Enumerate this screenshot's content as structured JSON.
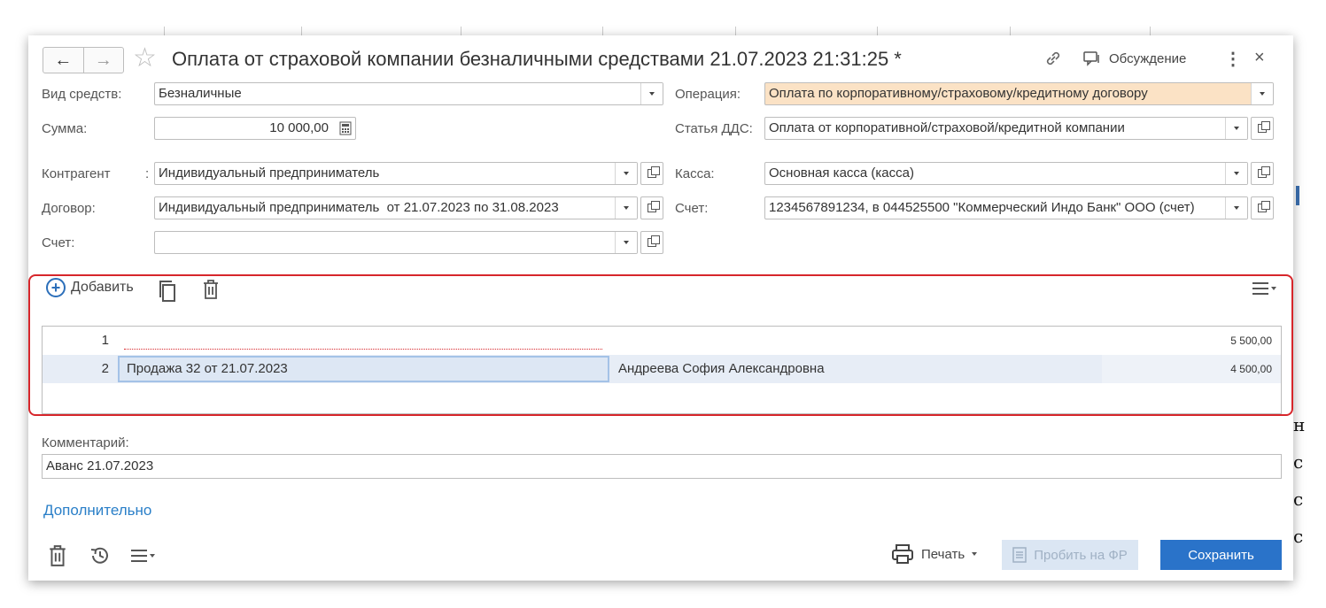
{
  "header": {
    "title": "Оплата от страховой компании безналичными средствами 21.07.2023 21:31:25 *",
    "discuss_label": "Обсуждение"
  },
  "form": {
    "left": [
      {
        "label": "Вид средств:",
        "value": ""
      },
      {
        "label": "Сумма:",
        "value": ""
      },
      {
        "label": "Контрагент",
        "value": ""
      },
      {
        "label": "Договор:",
        "value": ""
      },
      {
        "label": "Счет:",
        "value": ""
      }
    ],
    "fund_type": {
      "label": "Вид средств:",
      "value": "Безналичные"
    },
    "amount": {
      "label": "Сумма:",
      "value": "10 000,00"
    },
    "counterparty": {
      "label": "Контрагент",
      "colon": ":",
      "value": "Индивидуальный предприниматель"
    },
    "contract": {
      "label": "Договор:",
      "value": "Индивидуальный предприниматель  от 21.07.2023 по 31.08.2023"
    },
    "account_left": {
      "label": "Счет:",
      "value": ""
    },
    "operation": {
      "label": "Операция:",
      "value": "Оплата по корпоративному/страховому/кредитному договору"
    },
    "cashflow_item": {
      "label": "Статья ДДС:",
      "value": "Оплата от корпоративной/страховой/кредитной компании"
    },
    "cashbox": {
      "label": "Касса:",
      "value": "Основная касса (касса)"
    },
    "account_right": {
      "label": "Счет:",
      "value": "1234567891234, в 044525500 \"Коммерческий Индо Банк\" ООО (счет)"
    }
  },
  "table_toolbar": {
    "add_label": "Добавить"
  },
  "table": {
    "rows": [
      {
        "num": "1",
        "doc": "",
        "name": "",
        "amount": "5 500,00"
      },
      {
        "num": "2",
        "doc": "Продажа 32 от 21.07.2023",
        "name": "Андреева София Александровна",
        "amount": "4 500,00"
      }
    ]
  },
  "comment": {
    "label": "Комментарий:",
    "value": "Аванс 21.07.2023"
  },
  "more_label": "Дополнительно",
  "footer": {
    "print_label": "Печать",
    "fr_label": "Пробить на ФР",
    "save_label": "Сохранить"
  },
  "background": {
    "right_glyphs": [
      "н",
      "с",
      "с",
      "с"
    ]
  },
  "colors": {
    "accent": "#2a73c9",
    "highlight_border": "#d7262b",
    "orange_field": "#fbe2c5"
  },
  "icons": [
    "back-arrow-icon",
    "forward-arrow-icon",
    "star-icon",
    "link-icon",
    "discussion-icon",
    "kebab-icon",
    "close-icon",
    "calculator-icon",
    "open-icon",
    "plus-circle-icon",
    "copy-icon",
    "trash-icon",
    "list-menu-icon",
    "history-icon",
    "printer-icon",
    "receipt-icon"
  ]
}
